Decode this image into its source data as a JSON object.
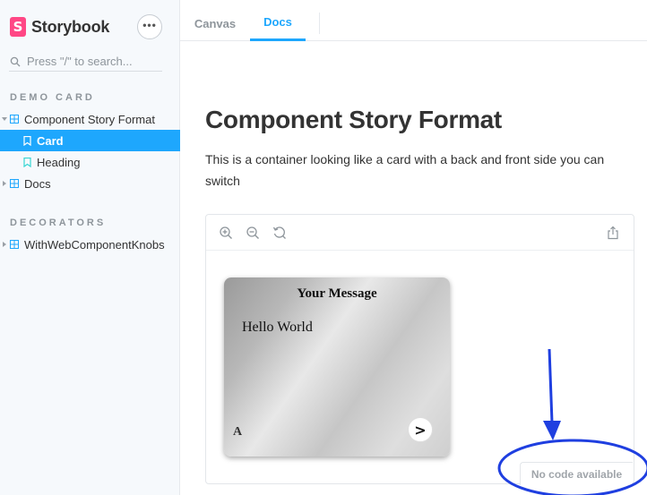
{
  "sidebar": {
    "brand": "Storybook",
    "menu_label": "•••",
    "search_placeholder": "Press \"/\" to search...",
    "sections": [
      {
        "title": "DEMO CARD",
        "items": [
          {
            "label": "Component Story Format"
          },
          {
            "label": "Card"
          },
          {
            "label": "Heading"
          },
          {
            "label": "Docs"
          }
        ]
      },
      {
        "title": "DECORATORS",
        "items": [
          {
            "label": "WithWebComponentKnobs"
          }
        ]
      }
    ]
  },
  "tabs": [
    {
      "label": "Canvas"
    },
    {
      "label": "Docs"
    }
  ],
  "doc": {
    "title": "Component Story Format",
    "description": "This is a container looking like a card with a back and front side you can switch"
  },
  "preview": {
    "card": {
      "title": "Your Message",
      "body": "Hello World",
      "corner_letter": "A",
      "flip_label": ">"
    },
    "no_code_label": "No code available"
  },
  "colors": {
    "accent": "#1ea7fd",
    "brand": "#ff4785",
    "annotation": "#1f3fe0"
  }
}
